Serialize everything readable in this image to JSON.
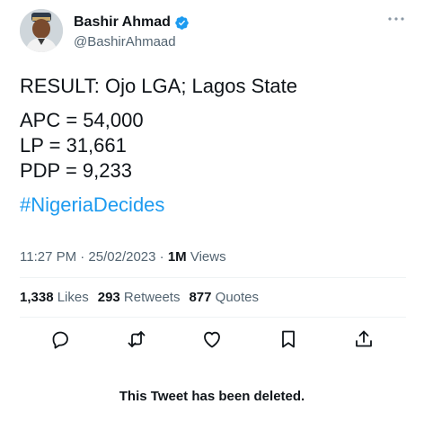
{
  "author": {
    "display_name": "Bashir Ahmad",
    "handle": "@BashirAhmaad",
    "verified": true
  },
  "tweet": {
    "line1": "RESULT: Ojo LGA; Lagos State",
    "line2": "APC = 54,000",
    "line3": "LP = 31,661",
    "line4": "PDP = 9,233",
    "hashtag": "#NigeriaDecides"
  },
  "meta": {
    "timestamp": "11:27 PM · 25/02/2023 · ",
    "views_count": "1M",
    "views_label": " Views"
  },
  "stats": {
    "likes_count": "1,338",
    "likes_label": " Likes",
    "retweets_count": "293",
    "retweets_label": " Retweets",
    "quotes_count": "877",
    "quotes_label": " Quotes"
  },
  "actions": [
    "reply-icon",
    "retweet-icon",
    "like-icon",
    "bookmark-icon",
    "share-icon"
  ],
  "notice": "This Tweet has been deleted.",
  "colors": {
    "link": "#1d9bf0",
    "verified": "#1d9bf0",
    "secondary_text": "#536471",
    "icon": "#0f1419"
  }
}
